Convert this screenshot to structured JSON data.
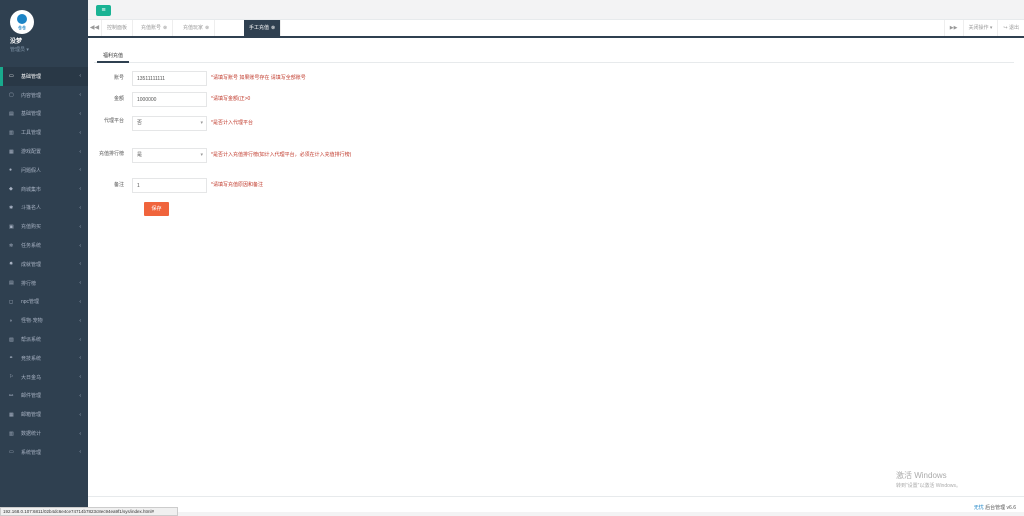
{
  "profile": {
    "logo_text": "仓仓",
    "name": "没梦",
    "role": "管理员 ▾"
  },
  "sidebar": {
    "items": [
      {
        "label": "基础管理",
        "icon": "▭",
        "active": true
      },
      {
        "label": "内容管理",
        "icon": "▢"
      },
      {
        "label": "基础管理",
        "icon": "▤"
      },
      {
        "label": "工具管理",
        "icon": "▥"
      },
      {
        "label": "游戏配置",
        "icon": "▦"
      },
      {
        "label": "问题假人",
        "icon": "●"
      },
      {
        "label": "商城集市",
        "icon": "◆"
      },
      {
        "label": "斗篷名人",
        "icon": "✱"
      },
      {
        "label": "充值购买",
        "icon": "▣"
      },
      {
        "label": "任务系统",
        "icon": "✲"
      },
      {
        "label": "成就管理",
        "icon": "✸"
      },
      {
        "label": "排行榜",
        "icon": "▤"
      },
      {
        "label": "npc管理",
        "icon": "◻"
      },
      {
        "label": "怪物·宠物",
        "icon": "◑"
      },
      {
        "label": "帮派系统",
        "icon": "▧"
      },
      {
        "label": "竞技系统",
        "icon": "⚭"
      },
      {
        "label": "大日金乌",
        "icon": "⚐"
      },
      {
        "label": "邮件管理",
        "icon": "⚯"
      },
      {
        "label": "邮箱管理",
        "icon": "▦"
      },
      {
        "label": "数据统计",
        "icon": "▥"
      },
      {
        "label": "系统管理",
        "icon": "▭"
      }
    ],
    "arrow": "‹"
  },
  "topbar": {
    "menu_icon": "≡"
  },
  "tabs": {
    "prev": "◀◀",
    "next": "▶▶",
    "items": [
      {
        "label": "控制面板",
        "close": ""
      },
      {
        "label": "充值账号",
        "close": "⊗"
      },
      {
        "label": "充值玩家",
        "close": "⊗"
      },
      {
        "label": "手工充值",
        "close": "⊗",
        "active": true
      }
    ],
    "ops_label": "关闭操作 ▾",
    "exit_label": "↪ 退出"
  },
  "form": {
    "tab_label": "福利充值",
    "fields": [
      {
        "label": "账号",
        "value": "13511111111",
        "hint": "*请填写账号 如果账号存在 请填写全部账号"
      },
      {
        "label": "金额",
        "value": "1000000",
        "hint": "*请填写金额(正>0"
      },
      {
        "label": "代理平台",
        "value": "否",
        "hint": "*是否计入代理平台"
      },
      {
        "label": "充值排行榜",
        "value": "是",
        "hint": "*是否计入充值排行榜(如计入代理平台，必须在计入充值排行榜)"
      },
      {
        "label": "备注",
        "value": "1",
        "hint": "*请填写充值原因和备注"
      }
    ],
    "select_caret": "▾",
    "save_label": "保存"
  },
  "watermark": {
    "title": "激活 Windows",
    "subtitle": "转到“设置”以激活 Windows。"
  },
  "footer": {
    "brand": "无忧",
    "text": "后台管理 v6.6"
  },
  "statusbar": {
    "url": "192.168.0.107:6811/02b4dc6e4ce74714b7823c8ec94ea9f1/sys/index.html#"
  }
}
